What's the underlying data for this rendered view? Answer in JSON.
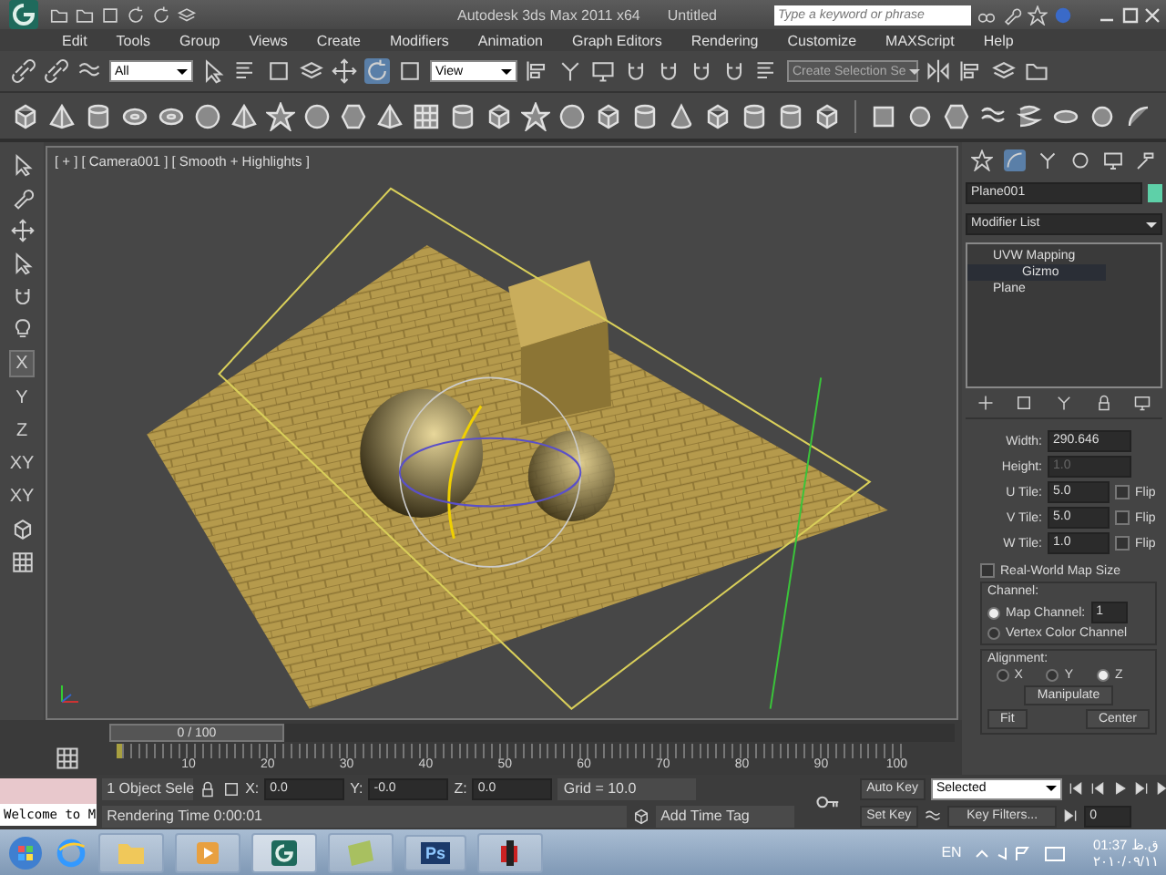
{
  "title_bar": {
    "title": "Autodesk 3ds Max  2011 x64",
    "document": "Untitled",
    "search": {
      "placeholder": "Type a keyword or phrase"
    }
  },
  "menu": [
    "Edit",
    "Tools",
    "Group",
    "Views",
    "Create",
    "Modifiers",
    "Animation",
    "Graph Editors",
    "Rendering",
    "Customize",
    "MAXScript",
    "Help"
  ],
  "main_toolbar": {
    "selection_filter": "All",
    "reference_coord": "View",
    "named_selection": "Create Selection Se"
  },
  "left_toolbar": {
    "axis_labels": [
      "X",
      "Y",
      "Z",
      "XY",
      "XY"
    ]
  },
  "viewport": {
    "labels": [
      "[ + ]",
      "[ Camera001 ]",
      "[ Smooth + Highlights ]"
    ]
  },
  "time_slider": {
    "position": "0 / 100",
    "level": 0
  },
  "track_bar": {
    "ticks": [
      "10",
      "20",
      "30",
      "40",
      "50",
      "60",
      "70",
      "80",
      "90",
      "100"
    ]
  },
  "status": {
    "listener": "Welcome to M",
    "selection": "1 Object Sele",
    "coords": [
      {
        "label": "X:",
        "value": "0.0"
      },
      {
        "label": "Y:",
        "value": "-0.0"
      },
      {
        "label": "Z:",
        "value": "0.0"
      }
    ],
    "grid": "Grid = 10.0",
    "prompt": "Rendering Time  0:00:01",
    "time_tag": "Add Time Tag"
  },
  "animation": {
    "auto_key": "Auto Key",
    "key_mode": "Selected",
    "set_key": "Set Key",
    "key_filters": "Key Filters...",
    "frame": "0"
  },
  "command_panel": {
    "object_name": "Plane001",
    "modifier_list": "Modifier List",
    "stack": [
      {
        "label": "UVW Mapping",
        "selected": false,
        "children": [
          {
            "label": "Gizmo",
            "selected": true
          }
        ]
      },
      {
        "label": "Plane",
        "selected": false
      }
    ],
    "params": {
      "width": {
        "label": "Width:",
        "value": "290.646",
        "disabled": false
      },
      "height": {
        "label": "Height:",
        "value": "1.0",
        "disabled": true
      },
      "tiles": [
        {
          "label": "U Tile:",
          "value": "5.0",
          "flip_label": "Flip",
          "flip": false
        },
        {
          "label": "V Tile:",
          "value": "5.0",
          "flip_label": "Flip",
          "flip": false
        },
        {
          "label": "W Tile:",
          "value": "1.0",
          "flip_label": "Flip",
          "flip": false
        }
      ],
      "real_world": {
        "label": "Real-World Map Size",
        "checked": false
      },
      "channel": {
        "title": "Channel:",
        "map_channel": "1",
        "options": [
          {
            "label": "Map Channel:",
            "selected": true
          },
          {
            "label": "Vertex Color Channel",
            "selected": false
          }
        ]
      },
      "alignment": {
        "title": "Alignment:",
        "axes": [
          {
            "label": "X",
            "selected": false
          },
          {
            "label": "Y",
            "selected": false
          },
          {
            "label": "Z",
            "selected": true
          }
        ],
        "manipulate": "Manipulate",
        "fit": "Fit",
        "center": "Center"
      }
    }
  },
  "taskbar": {
    "photoshop_label": "Ps",
    "language": "EN",
    "time": "01:37 ق.ظ",
    "date": "٢٠١٠/٠٩/١١"
  }
}
